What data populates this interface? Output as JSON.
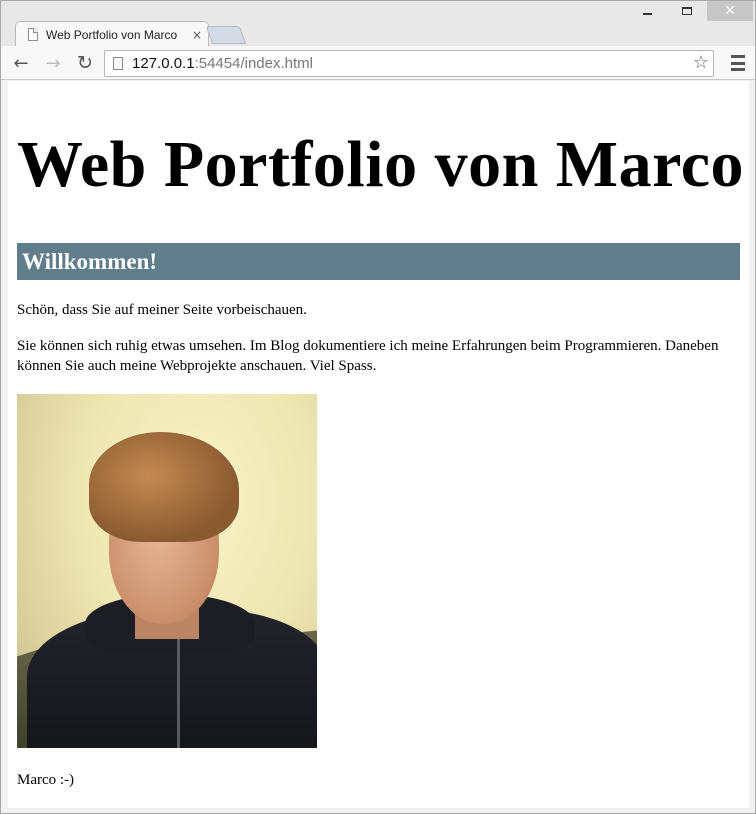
{
  "browser": {
    "tab": {
      "title": "Web Portfolio von Marco",
      "close_glyph": "×"
    },
    "window_controls": {
      "close_glyph": "✕"
    },
    "toolbar": {
      "back_glyph": "←",
      "forward_glyph": "→",
      "reload_glyph": "↻",
      "url_host": "127.0.0.1",
      "url_rest": ":54454/index.html",
      "bookmark_glyph": "☆"
    }
  },
  "page": {
    "heading": "Web Portfolio von Marco",
    "section_title": "Willkommen!",
    "paragraph_1": "Schön, dass Sie auf meiner Seite vorbeischauen.",
    "paragraph_2": "Sie können sich ruhig etwas umsehen. Im Blog dokumentiere ich meine Erfahrungen beim Programmieren. Daneben können Sie auch meine Webprojekte anschauen. Viel Spass.",
    "signoff": "Marco :-)"
  },
  "colors": {
    "section_bar": "#607d8b",
    "titlebar": "#e8e8e8",
    "toolbar": "#f8f8f8"
  },
  "icons": [
    "page-icon",
    "back-icon",
    "forward-icon",
    "reload-icon",
    "star-icon",
    "menu-icon",
    "close-icon",
    "minimize-icon",
    "maximize-icon"
  ]
}
